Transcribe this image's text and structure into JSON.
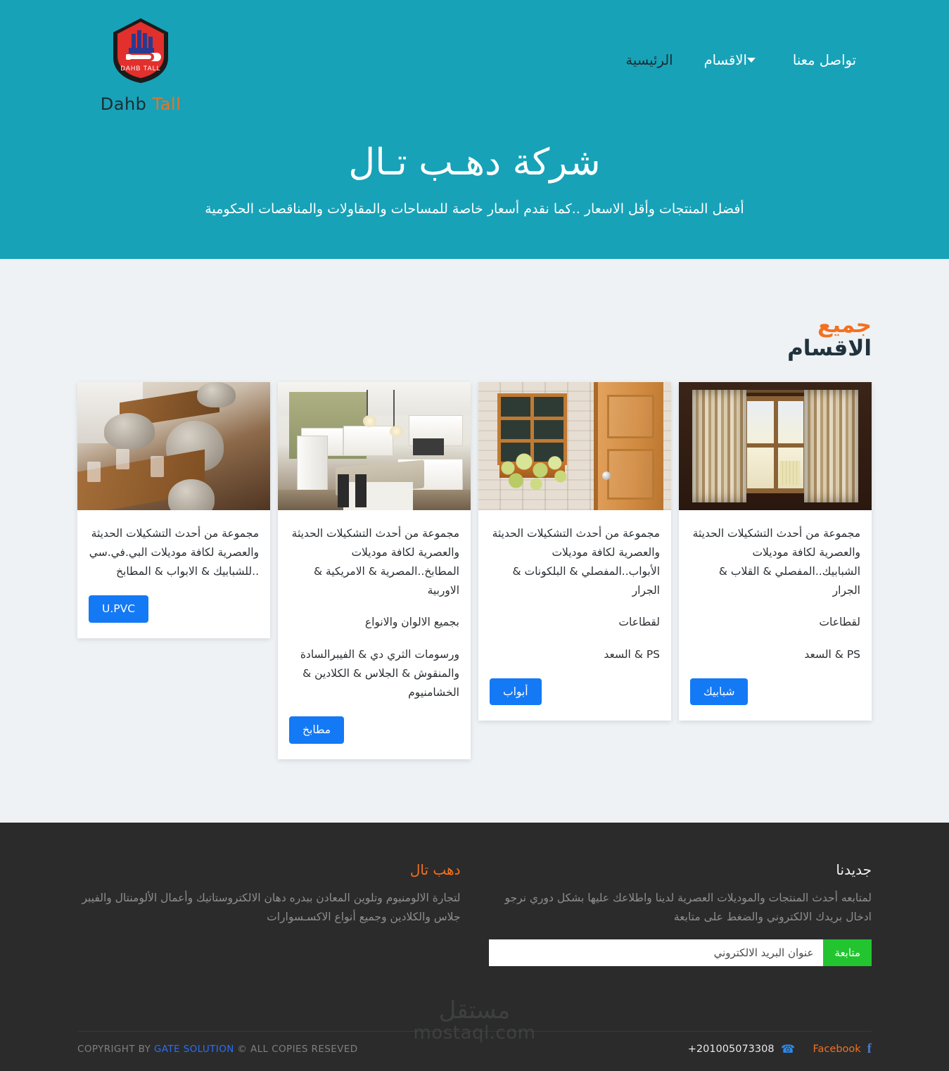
{
  "brand": {
    "name_part1": "Dahb",
    "name_part2": "Tall",
    "logo_text": "DAHB TALL",
    "logo_icon": "shield-wrench-logo"
  },
  "nav": {
    "items": [
      {
        "label": "الرئيسية",
        "state": "active",
        "icon": ""
      },
      {
        "label": "الاقسام",
        "state": "dropdown",
        "icon": "chevron-down-icon"
      },
      {
        "label": "تواصل معنا",
        "state": "normal",
        "icon": ""
      }
    ]
  },
  "hero": {
    "title": "شركة دهـب تـال",
    "subtitle": "أفضل المنتجات وأقل الاسعار  ..كما نقدم أسعار خاصة للمساحات والمقاولات والمناقصات الحكومية",
    "background_color": "#17a2b8"
  },
  "section": {
    "heading_line1": "جميع",
    "heading_line2": "الاقسام",
    "heading_color1": "#f4701f",
    "heading_color2": "#20323c"
  },
  "cards": [
    {
      "image_name": "restaurant-interior-photo",
      "paragraphs": [
        "مجموعة من أحدث التشكيلات الحديثة والعصرية لكافة موديلات البي.في.سي ..للشبابيك & الابواب & المطابخ"
      ],
      "button_label": "U.PVC",
      "button_color": "#1479f5"
    },
    {
      "image_name": "white-kitchen-photo",
      "paragraphs": [
        "مجموعة من أحدث التشكيلات الحديثة والعصرية لكافة موديلات المطابخ..المصرية & الامريكية & الاوربية",
        "بجميع الالوان والانواع",
        "ورسومات الثري دي & الفيبرالسادة والمنقوش & الجلاس & الكلادين & الخشامنيوم"
      ],
      "button_label": "مطابخ",
      "button_color": "#1479f5"
    },
    {
      "image_name": "brick-wall-door-window-photo",
      "paragraphs": [
        "مجموعة من أحدث التشكيلات الحديثة والعصرية لكافة موديلات الأبواب..المفصلي & البلكونات & الجرار",
        "لقطاعات",
        "PS & السعد"
      ],
      "button_label": "أبواب",
      "button_color": "#1479f5"
    },
    {
      "image_name": "curtained-window-photo",
      "paragraphs": [
        "مجموعة من أحدث التشكيلات الحديثة والعصرية لكافة موديلات الشبابيك..المفصلي & القلاب & الجرار",
        "لقطاعات",
        "PS & السعد"
      ],
      "button_label": "شبابيك",
      "button_color": "#1479f5"
    }
  ],
  "footer": {
    "about": {
      "title": "دهب تال",
      "text": "لتجارة الالومنيوم وتلوين المعادن ببدره دهان الالكتروستاتيك وأعمال الألومنتال والفيبر جلاس والكلادين وجميع أنواع الاكسـسوارات"
    },
    "newsletter": {
      "title": "جديدنا",
      "text": "لمتابعه أحدث المنتجات والموديلات العصرية لدينا واطلاعك عليها بشكل دوري نرجو ادخال بريدك الالكتروني والضغط على متابعة",
      "input_placeholder": "عنوان البريد الالكتروني",
      "input_value": "",
      "button_label": "متابعة",
      "button_color": "#22c52f"
    },
    "watermark": {
      "arabic": "مستقل",
      "latin": "mostaql.com"
    },
    "bottom": {
      "copyright_pre": "COPYRIGHT BY ",
      "copyright_brand": "GATE SOLUTION",
      "copyright_post": " © ALL COPIES RESEVED",
      "phone": "+201005073308",
      "phone_icon": "phone-icon",
      "facebook_label": "Facebook",
      "facebook_icon": "facebook-icon"
    }
  }
}
